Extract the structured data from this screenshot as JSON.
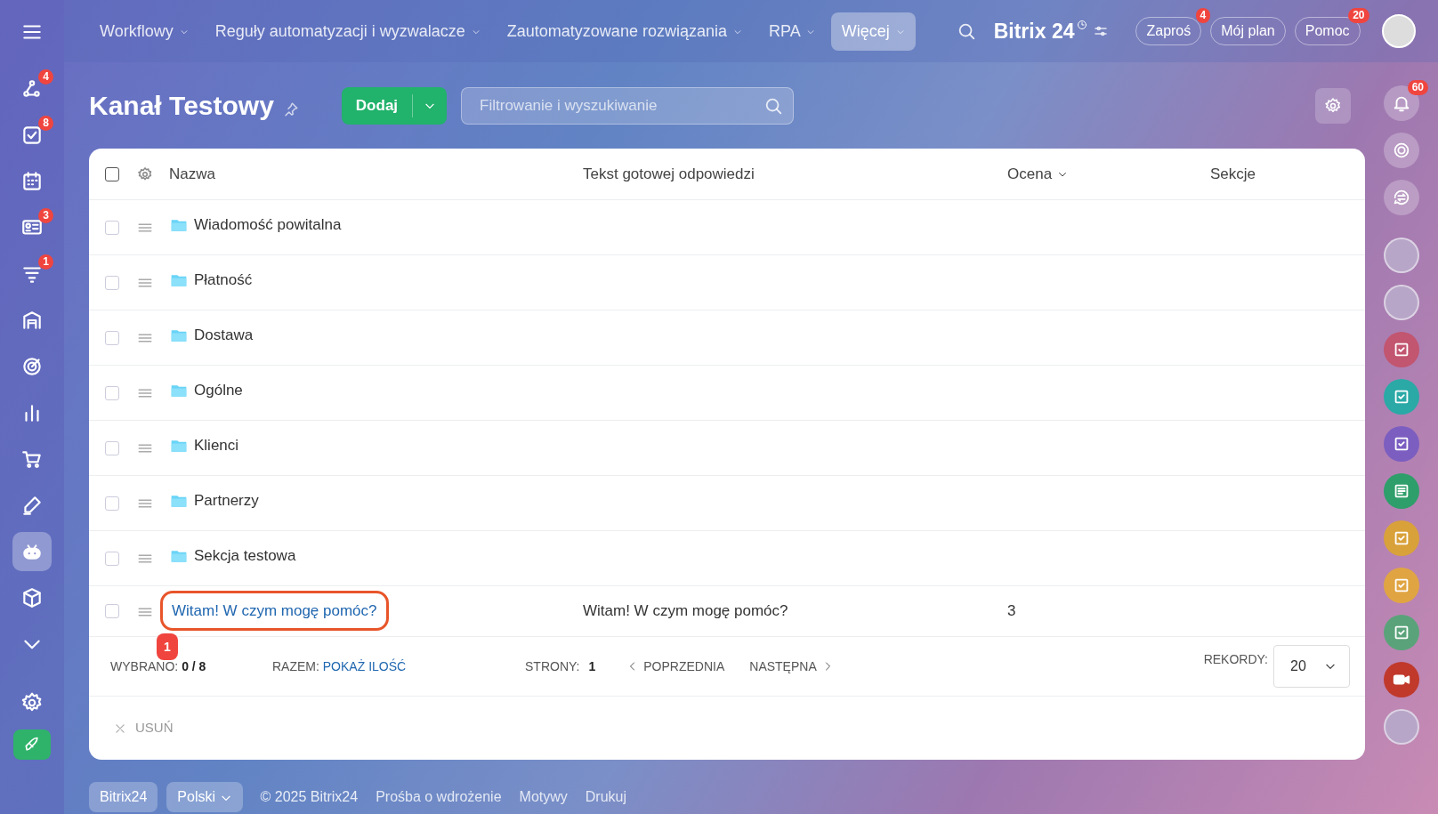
{
  "left_sidebar": {
    "items": [
      {
        "kind": "app",
        "selected": false
      },
      {
        "kind": "app",
        "badge": "4",
        "selected": false
      },
      {
        "kind": "app",
        "badge": "8",
        "selected": false
      },
      {
        "kind": "app",
        "selected": false
      },
      {
        "kind": "app",
        "badge": "3",
        "selected": false
      },
      {
        "kind": "app",
        "badge": "1",
        "selected": false
      },
      {
        "kind": "app",
        "selected": false
      },
      {
        "kind": "app",
        "selected": false
      },
      {
        "kind": "app",
        "selected": false
      },
      {
        "kind": "app",
        "selected": false
      },
      {
        "kind": "app",
        "selected": false
      },
      {
        "kind": "app",
        "selected": true
      },
      {
        "kind": "app",
        "selected": false
      },
      {
        "kind": "app",
        "selected": false
      },
      {
        "kind": "settings",
        "selected": false
      },
      {
        "kind": "launch"
      }
    ]
  },
  "top_nav": {
    "items": [
      {
        "label": "Workflowy",
        "selected": false
      },
      {
        "label": "Reguły automatyzacji i wyzwalacze",
        "selected": false
      },
      {
        "label": "Zautomatyzowane rozwiązania",
        "selected": false
      },
      {
        "label": "RPA",
        "selected": false
      },
      {
        "label": "Więcej",
        "selected": true
      }
    ],
    "logo": {
      "name": "Bitrix",
      "number": "24"
    },
    "buttons": [
      {
        "label": "Zaproś",
        "badge": "4"
      },
      {
        "label": "Mój plan"
      },
      {
        "label": "Pomoc",
        "badge": "20"
      }
    ]
  },
  "page": {
    "title": "Kanał Testowy",
    "add_button": "Dodaj",
    "search": {
      "placeholder": "Filtrowanie i wyszukiwanie"
    }
  },
  "table": {
    "columns": [
      {
        "label": "Nazwa"
      },
      {
        "label": "Tekst gotowej odpowiedzi"
      },
      {
        "label": "Ocena",
        "sortable": true
      },
      {
        "label": "Sekcje"
      }
    ],
    "header_checked": false,
    "rows": [
      {
        "kind": "folder",
        "name": "Wiadomość powitalna",
        "checked": false
      },
      {
        "kind": "folder",
        "name": "Płatność",
        "checked": false
      },
      {
        "kind": "folder",
        "name": "Dostawa",
        "checked": false
      },
      {
        "kind": "folder",
        "name": "Ogólne",
        "checked": false
      },
      {
        "kind": "folder",
        "name": "Klienci",
        "checked": false
      },
      {
        "kind": "folder",
        "name": "Partnerzy",
        "checked": false
      },
      {
        "kind": "folder",
        "name": "Sekcja testowa",
        "checked": false
      },
      {
        "kind": "answer",
        "name": "Witam! W czym mogę pomóc?",
        "text": "Witam! W czym mogę pomóc?",
        "rating": "3",
        "checked": false,
        "annotation": "1"
      }
    ]
  },
  "pager": {
    "selected_label": "WYBRANO:",
    "selected_value": "0 / 8",
    "total_label": "RAZEM:",
    "total_link": "POKAŻ ILOŚĆ",
    "pages_label": "STRONY:",
    "page": "1",
    "prev": "POPRZEDNIA",
    "next": "NASTĘPNA",
    "records_label": "REKORDY:",
    "records_value": "20"
  },
  "actions": [
    {
      "label": "USUŃ",
      "disabled": true
    }
  ],
  "right_sidebar": {
    "items": [
      {
        "kind": "bell",
        "badge": "60"
      },
      {
        "kind": "target"
      },
      {
        "kind": "chat"
      },
      {
        "kind": "avatar"
      },
      {
        "kind": "avatar"
      },
      {
        "kind": "task",
        "color": "#c2556f"
      },
      {
        "kind": "task",
        "color": "#2aa9a6"
      },
      {
        "kind": "task",
        "color": "#7b5ec0"
      },
      {
        "kind": "news",
        "color": "#2e9e6a"
      },
      {
        "kind": "task",
        "color": "#d9a13a"
      },
      {
        "kind": "task",
        "color": "#e0a542"
      },
      {
        "kind": "task",
        "color": "#5aa37a"
      },
      {
        "kind": "video",
        "color": "#c0392b"
      },
      {
        "kind": "avatar"
      }
    ]
  },
  "footer": {
    "logo": "Bitrix24",
    "language": "Polski",
    "copyright": "© 2025 Bitrix24",
    "links": [
      "Prośba o wdrożenie",
      "Motywy",
      "Drukuj"
    ]
  }
}
